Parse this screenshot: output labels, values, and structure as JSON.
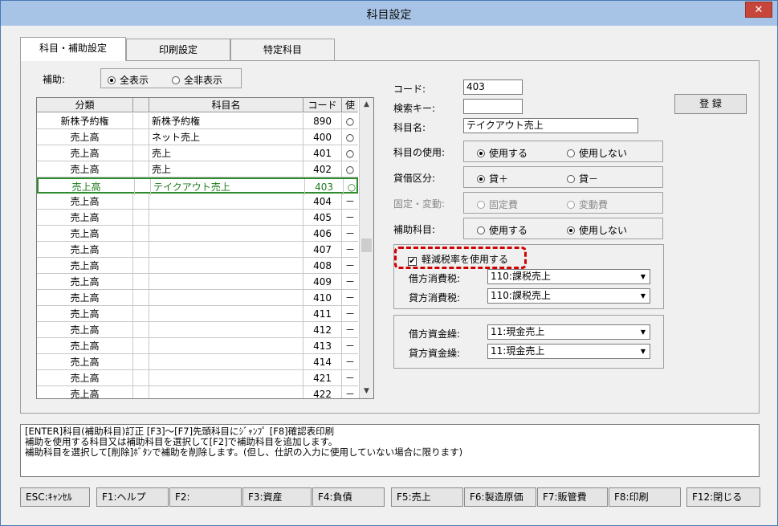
{
  "window": {
    "title": "科目設定",
    "close_label": "✕"
  },
  "tabs": [
    "科目・補助設定",
    "印刷設定",
    "特定科目"
  ],
  "filter": {
    "label": "補助:",
    "options": [
      "全表示",
      "全非表示"
    ],
    "selected": 0
  },
  "grid": {
    "columns": [
      "分類",
      "",
      "科目名",
      "コード",
      "使"
    ],
    "rows": [
      {
        "category": "新株予約権",
        "name": "新株予約権",
        "code": "890",
        "use": "○"
      },
      {
        "category": "売上高",
        "name": "ネット売上",
        "code": "400",
        "use": "○"
      },
      {
        "category": "売上高",
        "name": "売上",
        "code": "401",
        "use": "○"
      },
      {
        "category": "売上高",
        "name": "売上",
        "code": "402",
        "use": "○"
      },
      {
        "category": "売上高",
        "name": "テイクアウト売上",
        "code": "403",
        "use": "○"
      },
      {
        "category": "売上高",
        "name": "",
        "code": "404",
        "use": "－"
      },
      {
        "category": "売上高",
        "name": "",
        "code": "405",
        "use": "－"
      },
      {
        "category": "売上高",
        "name": "",
        "code": "406",
        "use": "－"
      },
      {
        "category": "売上高",
        "name": "",
        "code": "407",
        "use": "－"
      },
      {
        "category": "売上高",
        "name": "",
        "code": "408",
        "use": "－"
      },
      {
        "category": "売上高",
        "name": "",
        "code": "409",
        "use": "－"
      },
      {
        "category": "売上高",
        "name": "",
        "code": "410",
        "use": "－"
      },
      {
        "category": "売上高",
        "name": "",
        "code": "411",
        "use": "－"
      },
      {
        "category": "売上高",
        "name": "",
        "code": "412",
        "use": "－"
      },
      {
        "category": "売上高",
        "name": "",
        "code": "413",
        "use": "－"
      },
      {
        "category": "売上高",
        "name": "",
        "code": "414",
        "use": "－"
      },
      {
        "category": "売上高",
        "name": "",
        "code": "421",
        "use": "－"
      },
      {
        "category": "売上高",
        "name": "",
        "code": "422",
        "use": "－"
      }
    ],
    "selected_index": 4
  },
  "form": {
    "code_label": "コード:",
    "code_value": "403",
    "search_label": "検索キー:",
    "search_value": "",
    "name_label": "科目名:",
    "name_value": "テイクアウト売上",
    "register_button": "登 録",
    "usage": {
      "label": "科目の使用:",
      "options": [
        "使用する",
        "使用しない"
      ],
      "selected": 0
    },
    "debit_credit": {
      "label": "貸借区分:",
      "options": [
        "貸＋",
        "貸－"
      ],
      "selected": 0
    },
    "fixed_variable": {
      "label": "固定・変動:",
      "options": [
        "固定費",
        "変動費"
      ],
      "selected": -1
    },
    "sub_account": {
      "label": "補助科目:",
      "options": [
        "使用する",
        "使用しない"
      ],
      "selected": 1
    },
    "reduced_tax": {
      "label": "軽減税率を使用する",
      "checked": true
    },
    "debit_tax_label": "借方消費税:",
    "debit_tax_value": "110:課税売上",
    "credit_tax_label": "貸方消費税:",
    "credit_tax_value": "110:課税売上",
    "debit_fund_label": "借方資金繰:",
    "debit_fund_value": "11:現金売上",
    "credit_fund_label": "貸方資金繰:",
    "credit_fund_value": "11:現金売上"
  },
  "help_text": [
    "[ENTER]科目(補助科目)訂正 [F3]～[F7]先頭科目にｼﾞｬﾝﾌﾟ [F8]確認表印刷",
    "補助を使用する科目又は補助科目を選択して[F2]で補助科目を追加します。",
    "補助科目を選択して[削除]ﾎﾞﾀﾝで補助を削除します。(但し、仕訳の入力に使用していない場合に限ります)"
  ],
  "function_keys": [
    "ESC:ｷｬﾝｾﾙ",
    "F1:ヘルプ",
    "F2:",
    "F3:資産",
    "F4:負債",
    "F5:売上",
    "F6:製造原価",
    "F7:販管費",
    "F8:印刷",
    "F12:閉じる"
  ]
}
